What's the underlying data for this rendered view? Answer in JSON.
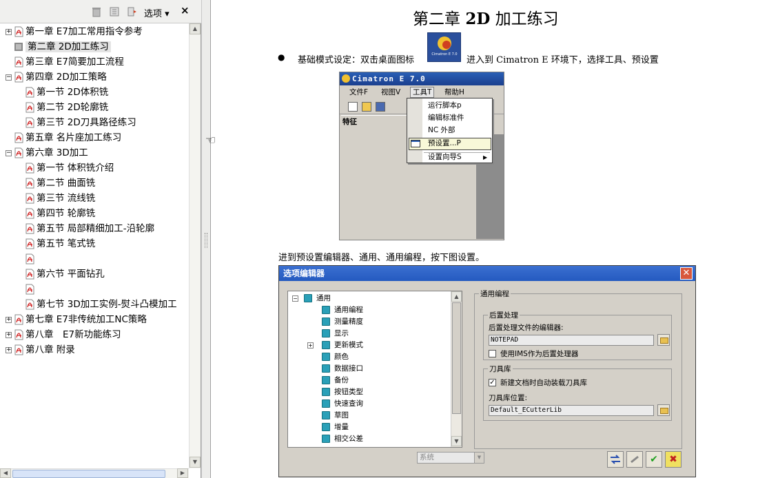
{
  "panel": {
    "options_label": "选项",
    "close_label": "×",
    "bookmarks": [
      {
        "label": "第一章 E7加工常用指令参考",
        "level": 0,
        "expander": "+",
        "selected": false
      },
      {
        "label": "第二章 2D加工练习",
        "level": 0,
        "expander": "",
        "selected": true
      },
      {
        "label": "第三章 E7简要加工流程",
        "level": 0,
        "expander": "",
        "selected": false
      },
      {
        "label": "第四章 2D加工策略",
        "level": 0,
        "expander": "−",
        "selected": false
      },
      {
        "label": "第一节 2D体积铣",
        "level": 1,
        "expander": "",
        "selected": false
      },
      {
        "label": "第二节 2D轮廓铣",
        "level": 1,
        "expander": "",
        "selected": false
      },
      {
        "label": "第三节 2D刀具路径练习",
        "level": 1,
        "expander": "",
        "selected": false
      },
      {
        "label": "第五章 名片座加工练习",
        "level": 0,
        "expander": "",
        "selected": false
      },
      {
        "label": "第六章 3D加工",
        "level": 0,
        "expander": "−",
        "selected": false
      },
      {
        "label": "第一节 体积铣介绍",
        "level": 1,
        "expander": "",
        "selected": false
      },
      {
        "label": "第二节 曲面铣",
        "level": 1,
        "expander": "",
        "selected": false
      },
      {
        "label": "第三节 流线铣",
        "level": 1,
        "expander": "",
        "selected": false
      },
      {
        "label": "第四节 轮廓铣",
        "level": 1,
        "expander": "",
        "selected": false
      },
      {
        "label": "第五节 局部精细加工-沿轮廓",
        "level": 1,
        "expander": "",
        "selected": false
      },
      {
        "label": "第五节 笔式铣",
        "level": 1,
        "expander": "",
        "selected": false
      },
      {
        "label": "",
        "level": 1,
        "expander": "",
        "selected": false
      },
      {
        "label": "第六节 平面钻孔",
        "level": 1,
        "expander": "",
        "selected": false
      },
      {
        "label": "",
        "level": 1,
        "expander": "",
        "selected": false
      },
      {
        "label": "第七节 3D加工实例-熨斗凸模加工",
        "level": 1,
        "expander": "",
        "selected": false
      },
      {
        "label": "第七章 E7非传统加工NC策略",
        "level": 0,
        "expander": "+",
        "selected": false
      },
      {
        "label": "第八章　E7新功能练习",
        "level": 0,
        "expander": "+",
        "selected": false
      },
      {
        "label": "第八章 附录",
        "level": 0,
        "expander": "+",
        "selected": false
      }
    ]
  },
  "doc": {
    "title_prefix": "第二章 ",
    "title_bold": "2D",
    "title_suffix": " 加工练习",
    "bullet": "●",
    "line1_a": "基础模式设定：双击桌面图标",
    "line1_b": "进入到 Cimatron E 环境下，选择工具、预设置",
    "line2": "进到预设置编辑器、通用、通用编程，按下图设置。",
    "icon_caption": "Cimatron E 7.0"
  },
  "cimatron": {
    "title": "Cimatron E 7.0",
    "menu": [
      "文件F",
      "视图V",
      "工具T",
      "帮助H"
    ],
    "feature_label": "特征",
    "dropdown": [
      "运行脚本p",
      "编辑标准件",
      "NC 外部",
      "预设置...P",
      "设置向导S"
    ]
  },
  "dialog": {
    "title": "选项编辑器",
    "tree": [
      {
        "label": "通用",
        "level": 0,
        "expander": "−"
      },
      {
        "label": "通用编程",
        "level": 1,
        "expander": ""
      },
      {
        "label": "测量精度",
        "level": 1,
        "expander": ""
      },
      {
        "label": "显示",
        "level": 1,
        "expander": ""
      },
      {
        "label": "更新模式",
        "level": 1,
        "expander": "+"
      },
      {
        "label": "颜色",
        "level": 1,
        "expander": ""
      },
      {
        "label": "数据接口",
        "level": 1,
        "expander": ""
      },
      {
        "label": "备份",
        "level": 1,
        "expander": ""
      },
      {
        "label": "按钮类型",
        "level": 1,
        "expander": ""
      },
      {
        "label": "快速查询",
        "level": 1,
        "expander": ""
      },
      {
        "label": "草图",
        "level": 1,
        "expander": ""
      },
      {
        "label": "增量",
        "level": 1,
        "expander": ""
      },
      {
        "label": "相交公差",
        "level": 1,
        "expander": ""
      }
    ],
    "group_title": "通用编程",
    "post": {
      "title": "后置处理",
      "editor_label": "后置处理文件的编辑器:",
      "editor_value": "NOTEPAD",
      "ims_label": "使用IMS作为后置处理器",
      "ims_checked": false
    },
    "tools": {
      "title": "刀具库",
      "autoload_label": "新建文档时自动装载刀具库",
      "autoload_checked": true,
      "location_label": "刀具库位置:",
      "location_value": "Default_ECutterLib"
    },
    "combo_value": "系统"
  }
}
